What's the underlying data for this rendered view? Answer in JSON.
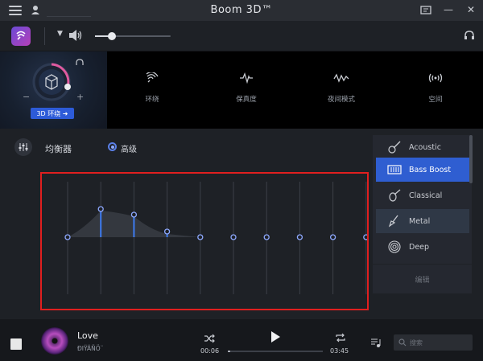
{
  "app": {
    "title": "Boom 3D™"
  },
  "volume": {
    "level": 0.22
  },
  "effect_3d": {
    "button_label": "3D 环绕 ➜"
  },
  "effects": [
    {
      "icon": "ambience-icon",
      "label": "环绕"
    },
    {
      "icon": "fidelity-icon",
      "label": "保真度"
    },
    {
      "icon": "night-mode-icon",
      "label": "夜间模式"
    },
    {
      "icon": "spatial-icon",
      "label": "空间"
    }
  ],
  "equalizer": {
    "title": "均衡器",
    "mode_label": "高级",
    "bands": [
      0,
      0.5,
      0.4,
      0.1,
      0,
      0,
      0,
      0,
      0,
      0
    ]
  },
  "presets": [
    {
      "name": "Acoustic",
      "icon": "acoustic-guitar-icon",
      "state": "normal"
    },
    {
      "name": "Bass Boost",
      "icon": "bass-boost-icon",
      "state": "active"
    },
    {
      "name": "Classical",
      "icon": "violin-icon",
      "state": "normal"
    },
    {
      "name": "Metal",
      "icon": "electric-guitar-icon",
      "state": "hover"
    },
    {
      "name": "Deep",
      "icon": "deep-icon",
      "state": "normal"
    }
  ],
  "presets_edit_label": "编辑",
  "player": {
    "song": "Love",
    "artist": "ÐIŸÄÑÖ¨",
    "current_time": "00:06",
    "total_time": "03:45",
    "progress": 0.027
  },
  "search": {
    "placeholder": "搜索"
  },
  "colors": {
    "accent": "#2f5ed1",
    "highlight_box": "#e01f1f",
    "ring": "#e05aa0"
  }
}
